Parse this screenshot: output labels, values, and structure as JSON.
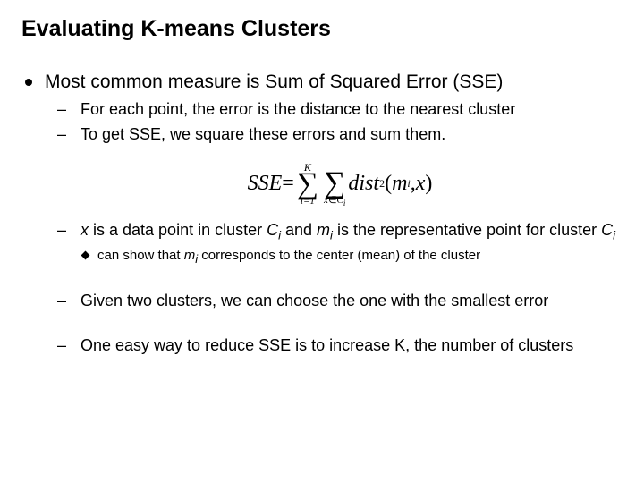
{
  "title": "Evaluating K-means Clusters",
  "main_point": "Most common measure is Sum of Squared Error (SSE)",
  "sub": {
    "a": "For each point, the error is the distance to the nearest cluster",
    "b": "To get SSE, we square these errors and sum them.",
    "c_pre": "x",
    "c_mid1": " is a data point in cluster ",
    "c_ci": "C",
    "c_i": "i",
    "c_mid2": " and ",
    "c_mi": "m",
    "c_mid3": " is the representative point for cluster ",
    "d_pre": "can show that ",
    "d_mid": " corresponds to the center (mean) of the cluster",
    "e": "Given two clusters, we can choose the one with the smallest error",
    "f": "One easy way to reduce SSE is to increase K, the number of clusters"
  },
  "formula": {
    "lhs": "SSE",
    "eq": " = ",
    "sig1_top": "K",
    "sig1_bot": "i=1",
    "sig2_bot_a": "x",
    "sig2_bot_b": "∈C",
    "sig2_bot_c": "i",
    "dist": "dist",
    "sup2": "2",
    "open": "(",
    "m": "m",
    "mi": "i",
    "comma": ", ",
    "x": "x",
    "close": ")"
  }
}
